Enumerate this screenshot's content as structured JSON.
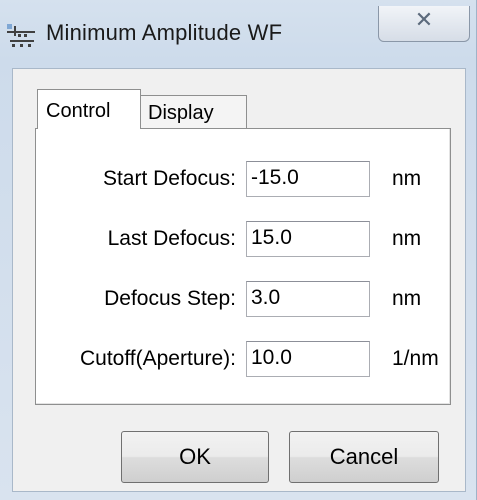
{
  "window": {
    "title": "Minimum Amplitude WF",
    "close_glyph": "✕"
  },
  "tabs": [
    {
      "label": "Control",
      "active": true
    },
    {
      "label": "Display",
      "active": false
    }
  ],
  "fields": [
    {
      "label": "Start Defocus:",
      "value": "-15.0",
      "unit": "nm"
    },
    {
      "label": "Last Defocus:",
      "value": "15.0",
      "unit": "nm"
    },
    {
      "label": "Defocus Step:",
      "value": "3.0",
      "unit": "nm"
    },
    {
      "label": "Cutoff(Aperture):",
      "value": "10.0",
      "unit": "1/nm"
    }
  ],
  "buttons": {
    "ok": "OK",
    "cancel": "Cancel"
  }
}
